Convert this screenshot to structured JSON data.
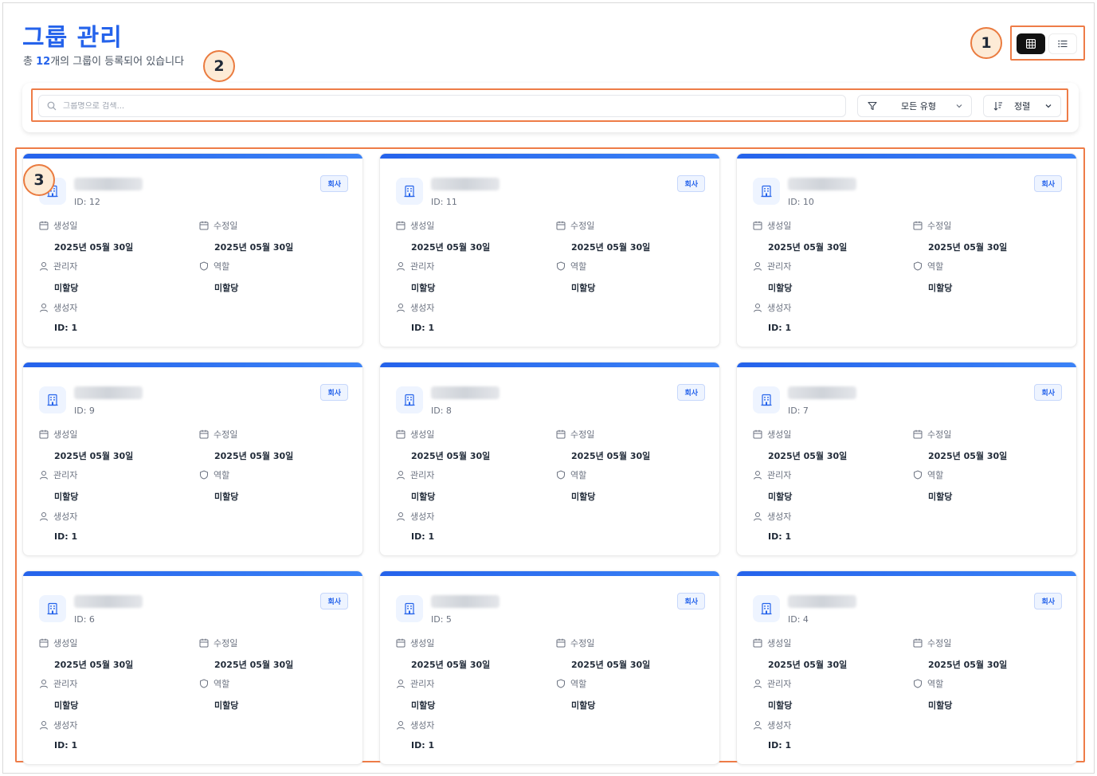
{
  "page": {
    "title": "그룹 관리",
    "subtitle_prefix": "총 ",
    "group_count": "12",
    "subtitle_suffix": "개의 그룹이 등록되어 있습니다"
  },
  "view_toggle": {
    "grid_icon": "grid-icon",
    "list_icon": "list-icon",
    "active": "grid"
  },
  "toolbar": {
    "search_placeholder": "그룹명으로 검색...",
    "type_filter_label": "모든 유형",
    "sort_label": "정렬"
  },
  "callouts": [
    "1",
    "2",
    "3"
  ],
  "labels": {
    "created": "생성일",
    "updated": "수정일",
    "manager": "관리자",
    "role": "역할",
    "creator": "생성자"
  },
  "cards": [
    {
      "id": "ID: 12",
      "tag": "회사",
      "created": "2025년 05월 30일",
      "updated": "2025년 05월 30일",
      "manager": "미할당",
      "role": "미할당",
      "creator": "ID: 1"
    },
    {
      "id": "ID: 11",
      "tag": "회사",
      "created": "2025년 05월 30일",
      "updated": "2025년 05월 30일",
      "manager": "미할당",
      "role": "미할당",
      "creator": "ID: 1"
    },
    {
      "id": "ID: 10",
      "tag": "회사",
      "created": "2025년 05월 30일",
      "updated": "2025년 05월 30일",
      "manager": "미할당",
      "role": "미할당",
      "creator": "ID: 1"
    },
    {
      "id": "ID: 9",
      "tag": "회사",
      "created": "2025년 05월 30일",
      "updated": "2025년 05월 30일",
      "manager": "미할당",
      "role": "미할당",
      "creator": "ID: 1"
    },
    {
      "id": "ID: 8",
      "tag": "회사",
      "created": "2025년 05월 30일",
      "updated": "2025년 05월 30일",
      "manager": "미할당",
      "role": "미할당",
      "creator": "ID: 1"
    },
    {
      "id": "ID: 7",
      "tag": "회사",
      "created": "2025년 05월 30일",
      "updated": "2025년 05월 30일",
      "manager": "미할당",
      "role": "미할당",
      "creator": "ID: 1"
    },
    {
      "id": "ID: 6",
      "tag": "회사",
      "created": "2025년 05월 30일",
      "updated": "2025년 05월 30일",
      "manager": "미할당",
      "role": "미할당",
      "creator": "ID: 1"
    },
    {
      "id": "ID: 5",
      "tag": "회사",
      "created": "2025년 05월 30일",
      "updated": "2025년 05월 30일",
      "manager": "미할당",
      "role": "미할당",
      "creator": "ID: 1"
    },
    {
      "id": "ID: 4",
      "tag": "회사",
      "created": "2025년 05월 30일",
      "updated": "2025년 05월 30일",
      "manager": "미할당",
      "role": "미할당",
      "creator": "ID: 1"
    }
  ],
  "colors": {
    "accent": "#2563eb",
    "callout": "#ee7c47"
  }
}
